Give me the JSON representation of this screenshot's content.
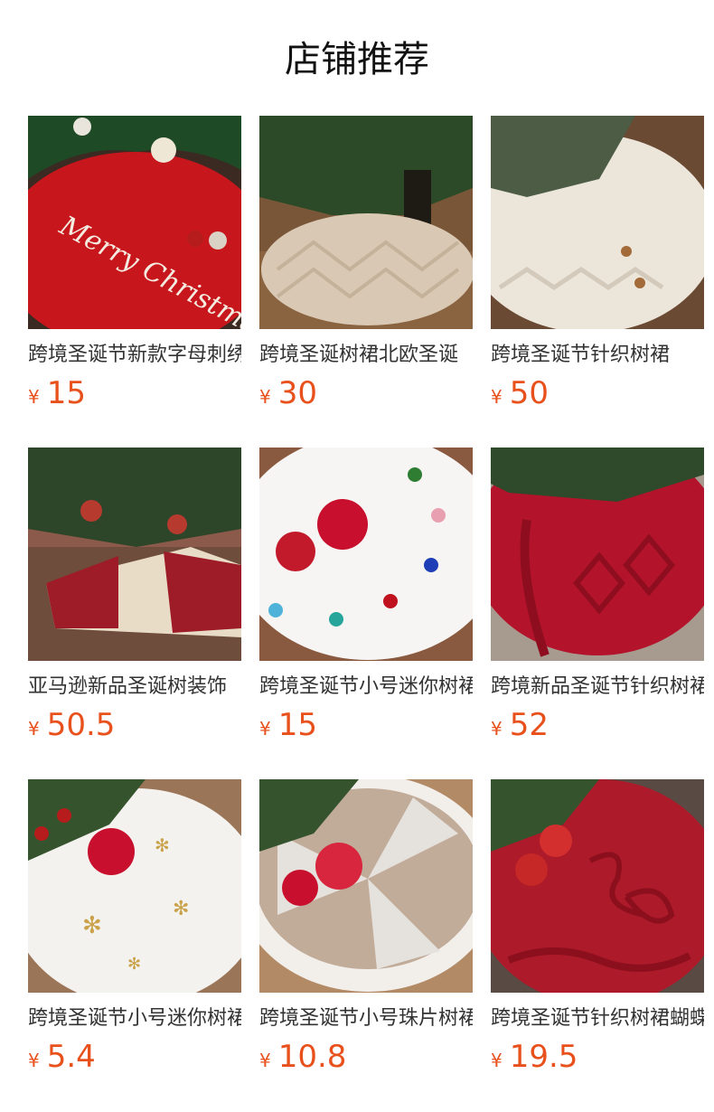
{
  "header": {
    "title": "店铺推荐"
  },
  "currency_symbol": "¥",
  "colors": {
    "price": "#e8501c",
    "title": "#111111",
    "name": "#333333"
  },
  "products": [
    {
      "name": "跨境圣诞节新款字母刺绣",
      "price": "15",
      "image_icon": "tree-skirt-red-merry-christmas-icon",
      "image_text": "Merry Christmas"
    },
    {
      "name": "跨境圣诞树裙北欧圣诞",
      "price": "30",
      "image_icon": "tree-skirt-beige-plush-icon"
    },
    {
      "name": "跨境圣诞节针织树裙",
      "price": "50",
      "image_icon": "tree-skirt-white-knit-icon"
    },
    {
      "name": "亚马逊新品圣诞树装饰",
      "price": "50.5",
      "image_icon": "tree-skirt-red-white-stripe-icon"
    },
    {
      "name": "跨境圣诞节小号迷你树裙",
      "price": "15",
      "image_icon": "tree-skirt-white-paw-print-icon"
    },
    {
      "name": "跨境新品圣诞节针织树裙",
      "price": "52",
      "image_icon": "tree-skirt-red-cable-knit-icon"
    },
    {
      "name": "跨境圣诞节小号迷你树裙",
      "price": "5.4",
      "image_icon": "tree-skirt-white-plush-snowflake-icon"
    },
    {
      "name": "跨境圣诞节小号珠片树裙",
      "price": "10.8",
      "image_icon": "tree-skirt-sequin-icon"
    },
    {
      "name": "跨境圣诞节针织树裙蝴蝶结",
      "price": "19.5",
      "image_icon": "tree-skirt-red-knit-bow-icon"
    }
  ]
}
